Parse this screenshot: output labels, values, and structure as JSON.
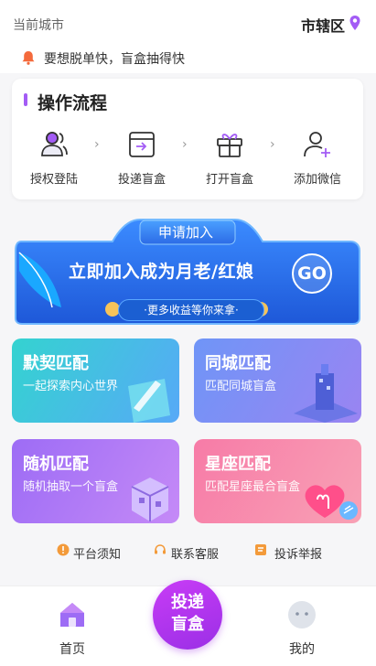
{
  "header": {
    "city_label": "当前城市",
    "city_value": "市辖区",
    "pin_icon": "location-pin-icon",
    "accent": "#a35cf5"
  },
  "notice": {
    "icon": "bell-icon",
    "text": "要想脱单快，盲盒抽得快",
    "icon_color": "#f46a3c"
  },
  "process": {
    "title": "操作流程",
    "steps": [
      {
        "label": "授权登陆",
        "icon": "users-icon"
      },
      {
        "label": "投递盲盒",
        "icon": "box-in-icon"
      },
      {
        "label": "打开盲盒",
        "icon": "gift-icon"
      },
      {
        "label": "添加微信",
        "icon": "add-user-icon"
      }
    ],
    "arrow": "›"
  },
  "banner": {
    "tab": "申请加入",
    "main": "立即加入成为月老/红娘",
    "go": "GO",
    "sub": "·更多收益等你来拿·"
  },
  "tiles": [
    {
      "title": "默契匹配",
      "sub": "一起探索内心世界",
      "colors": [
        "#34d3d0",
        "#57a9f7"
      ]
    },
    {
      "title": "同城匹配",
      "sub": "匹配同城盲盒",
      "colors": [
        "#6f95f7",
        "#9a84f2"
      ]
    },
    {
      "title": "随机匹配",
      "sub": "随机抽取一个盲盒",
      "colors": [
        "#9d6cf5",
        "#c58af7"
      ]
    },
    {
      "title": "星座匹配",
      "sub": "匹配星座最合盲盒",
      "colors": [
        "#f77ba7",
        "#f8a1b5"
      ]
    }
  ],
  "links": [
    {
      "label": "平台须知",
      "icon": "info-icon"
    },
    {
      "label": "联系客服",
      "icon": "headset-icon"
    },
    {
      "label": "投诉举报",
      "icon": "report-icon"
    }
  ],
  "tabbar": {
    "home": "首页",
    "fab_line1": "投递",
    "fab_line2": "盲盒",
    "mine": "我的"
  }
}
